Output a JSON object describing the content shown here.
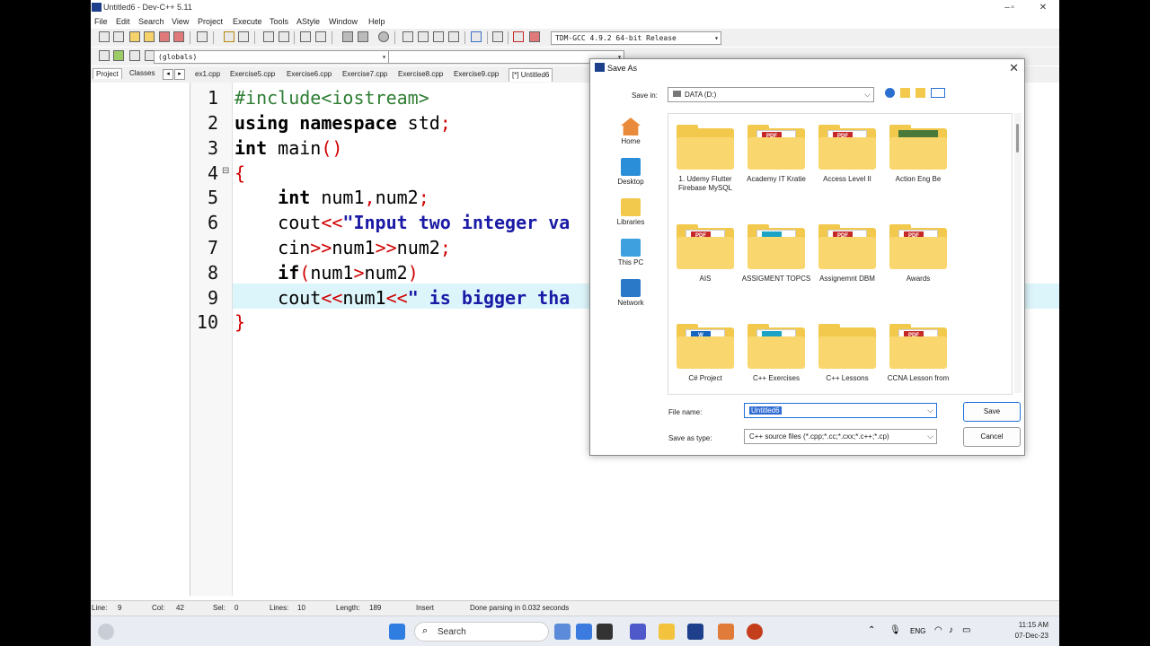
{
  "window": {
    "title": "Untitled6 - Dev-C++ 5.11"
  },
  "menu": [
    "File",
    "Edit",
    "Search",
    "View",
    "Project",
    "Execute",
    "Tools",
    "AStyle",
    "Window",
    "Help"
  ],
  "toolbar": {
    "compiler": "TDM-GCC 4.9.2 64-bit Release",
    "scope": "(globals)"
  },
  "side_tabs": [
    "Project",
    "Classes"
  ],
  "file_tabs": [
    "ex1.cpp",
    "Exercise5.cpp",
    "Exercise6.cpp",
    "Exercise7.cpp",
    "Exercise8.cpp",
    "Exercise9.cpp",
    "[*] Untitled6"
  ],
  "editor": {
    "lines": [
      {
        "n": "1",
        "text": "#include<iostream>"
      },
      {
        "n": "2",
        "text": "using namespace std;"
      },
      {
        "n": "3",
        "text": "int main()"
      },
      {
        "n": "4",
        "text": "{"
      },
      {
        "n": "5",
        "text": "    int num1,num2;"
      },
      {
        "n": "6",
        "text": "    cout<<\"Input two integer va"
      },
      {
        "n": "7",
        "text": "    cin>>num1>>num2;"
      },
      {
        "n": "8",
        "text": "    if(num1>num2)"
      },
      {
        "n": "9",
        "text": "    cout<<num1<<\" is bigger tha"
      },
      {
        "n": "10",
        "text": "}"
      }
    ],
    "highlighted_line": 9
  },
  "status": {
    "line_label": "Line:",
    "line": "9",
    "col_label": "Col:",
    "col": "42",
    "sel_label": "Sel:",
    "sel": "0",
    "lines_label": "Lines:",
    "lines": "10",
    "length_label": "Length:",
    "length": "189",
    "mode": "Insert",
    "message": "Done parsing in 0.032 seconds"
  },
  "dialog": {
    "title": "Save As",
    "save_in_label": "Save in:",
    "save_in_value": "DATA (D:)",
    "places": [
      "Home",
      "Desktop",
      "Libraries",
      "This PC",
      "Network"
    ],
    "folders": [
      {
        "name": "1. Udemy Flutter Firebase MySQL",
        "badge": ""
      },
      {
        "name": "Academy IT Kratie",
        "badge": "PDF"
      },
      {
        "name": "Access Level II",
        "badge": "PDF"
      },
      {
        "name": "Action Eng Be",
        "badge": "photo"
      },
      {
        "name": "AIS",
        "badge": "PDF"
      },
      {
        "name": "ASSIGMENT TOPCS",
        "badge": "teal"
      },
      {
        "name": "Assignemnt DBM",
        "badge": "PDF"
      },
      {
        "name": "Awards",
        "badge": "PDF"
      },
      {
        "name": "C# Project",
        "badge": "W"
      },
      {
        "name": "C++ Exercises",
        "badge": "teal"
      },
      {
        "name": "C++ Lessons",
        "badge": ""
      },
      {
        "name": "CCNA Lesson from",
        "badge": "PDF"
      }
    ],
    "file_name_label": "File name:",
    "file_name_value": "Untitled6",
    "save_type_label": "Save as type:",
    "save_type_value": "C++ source files (*.cpp;*.cc;*.cxx;*.c++;*.cp)",
    "save_button": "Save",
    "cancel_button": "Cancel"
  },
  "taskbar": {
    "search_label": "Search",
    "lang": "ENG",
    "time": "11:15 AM",
    "date": "07-Dec-23"
  }
}
